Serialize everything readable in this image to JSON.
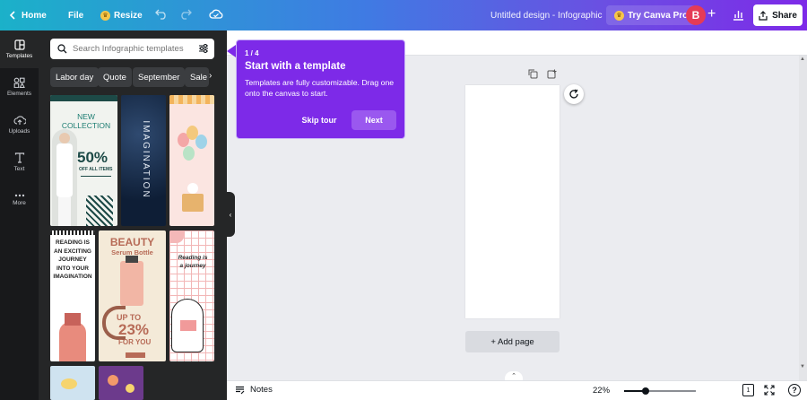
{
  "topbar": {
    "home_label": "Home",
    "file_label": "File",
    "resize_label": "Resize",
    "design_title": "Untitled design - Infographic",
    "pro_label": "Try Canva Pro",
    "avatar_initial": "B",
    "share_label": "Share"
  },
  "rail": {
    "items": [
      {
        "label": "Templates",
        "icon": "templates-icon"
      },
      {
        "label": "Elements",
        "icon": "elements-icon"
      },
      {
        "label": "Uploads",
        "icon": "upload-icon"
      },
      {
        "label": "Text",
        "icon": "text-icon"
      },
      {
        "label": "More",
        "icon": "more-icon"
      }
    ]
  },
  "panel": {
    "search_placeholder": "Search Infographic templates",
    "chips": [
      "Labor day",
      "Quote",
      "September",
      "Sale"
    ],
    "templates": {
      "t1_line1": "NEW",
      "t1_line2": "COLLECTION",
      "t1_big": "50%",
      "t1_sub": "OFF ALL ITEMS",
      "t2_word": "IMAGINATION",
      "t4_text": "READING IS AN EXCITING JOURNEY INTO YOUR IMAGINATION",
      "t5_title": "BEAUTY",
      "t5_sub": "Serum Bottle",
      "t5_upto": "UP TO",
      "t5_pct": "23%",
      "t5_foryou": "FOR YOU",
      "t6_text": "Reading is a journey"
    }
  },
  "tour": {
    "step": "1 / 4",
    "title": "Start with a template",
    "body": "Templates are fully customizable. Drag one onto the canvas to start.",
    "skip_label": "Skip tour",
    "next_label": "Next"
  },
  "canvas": {
    "add_page_label": "+ Add page"
  },
  "bottom": {
    "notes_label": "Notes",
    "zoom": "22%",
    "zoom_fraction": 0.3,
    "page_count": "1"
  },
  "colors": {
    "accent": "#7d2ae8",
    "rail_bg": "#18191b",
    "panel_bg": "#252627"
  }
}
